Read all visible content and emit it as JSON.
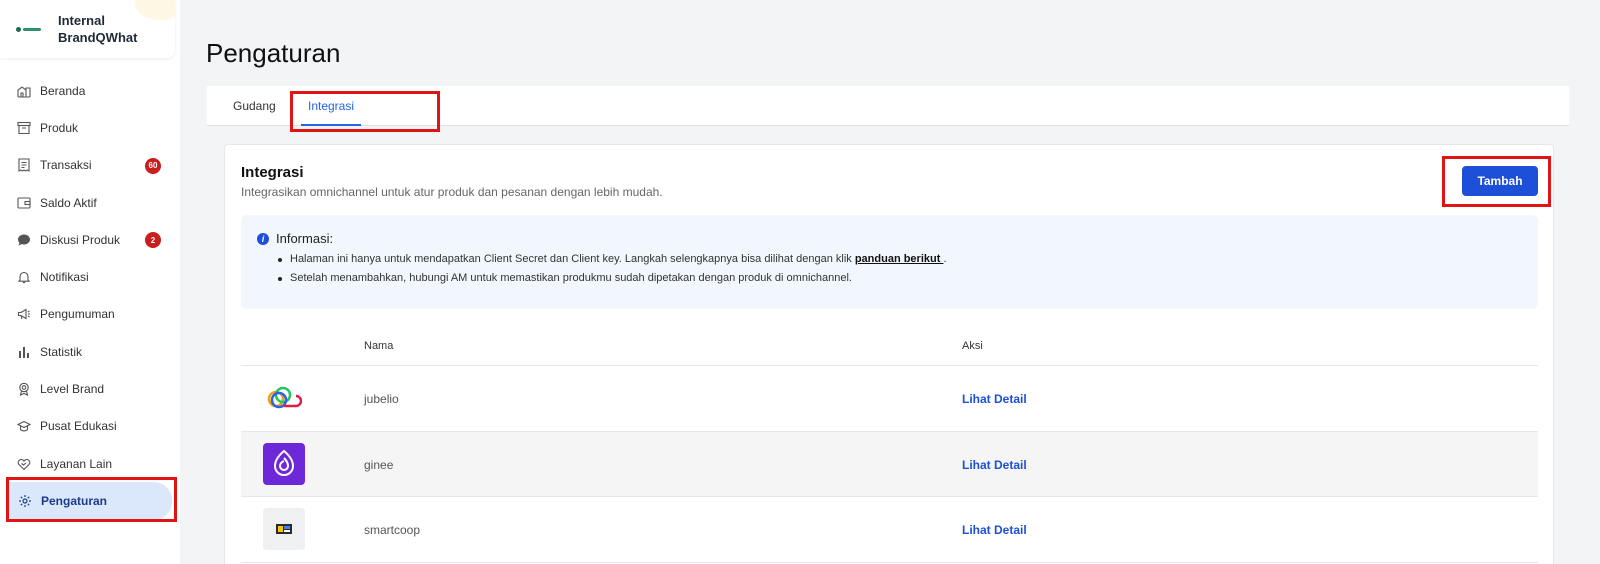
{
  "brand": {
    "name": "Internal BrandQWhat"
  },
  "sidebar": {
    "items": [
      {
        "label": "Beranda",
        "icon": "home-icon"
      },
      {
        "label": "Produk",
        "icon": "box-icon"
      },
      {
        "label": "Transaksi",
        "icon": "receipt-icon",
        "badge": "60"
      },
      {
        "label": "Saldo Aktif",
        "icon": "wallet-icon"
      },
      {
        "label": "Diskusi Produk",
        "icon": "chat-icon",
        "badge": "2"
      },
      {
        "label": "Notifikasi",
        "icon": "bell-icon"
      },
      {
        "label": "Pengumuman",
        "icon": "megaphone-icon"
      },
      {
        "label": "Statistik",
        "icon": "bar-chart-icon"
      },
      {
        "label": "Level Brand",
        "icon": "medal-icon"
      },
      {
        "label": "Pusat Edukasi",
        "icon": "graduation-cap-icon"
      },
      {
        "label": "Layanan Lain",
        "icon": "heart-handshake-icon"
      },
      {
        "label": "Pengaturan",
        "icon": "gear-icon",
        "active": true
      }
    ]
  },
  "page": {
    "title": "Pengaturan"
  },
  "tabs": [
    {
      "label": "Gudang"
    },
    {
      "label": "Integrasi",
      "active": true
    }
  ],
  "integration": {
    "title": "Integrasi",
    "subtitle": "Integrasikan omnichannel untuk atur produk dan pesanan dengan lebih mudah.",
    "add_label": "Tambah",
    "info": {
      "title": "Informasi:",
      "line1_prefix": "Halaman ini hanya untuk mendapatkan Client Secret dan Client key. Langkah selengkapnya bisa dilihat dengan klik ",
      "line1_link": "panduan berikut ",
      "line1_suffix": ".",
      "line2": "Setelah menambahkan, hubungi AM untuk memastikan produkmu sudah dipetakan dengan produk di omnichannel."
    },
    "table": {
      "headers": {
        "name": "Nama",
        "action": "Aksi"
      },
      "rows": [
        {
          "name": "jubelio",
          "action": "Lihat Detail",
          "logo": "jubelio-logo"
        },
        {
          "name": "ginee",
          "action": "Lihat Detail",
          "logo": "ginee-logo"
        },
        {
          "name": "smartcoop",
          "action": "Lihat Detail",
          "logo": "smartcoop-logo"
        }
      ]
    }
  },
  "colors": {
    "accent": "#1d4fd8",
    "highlight": "#e01414",
    "badge": "#c81e1e"
  }
}
